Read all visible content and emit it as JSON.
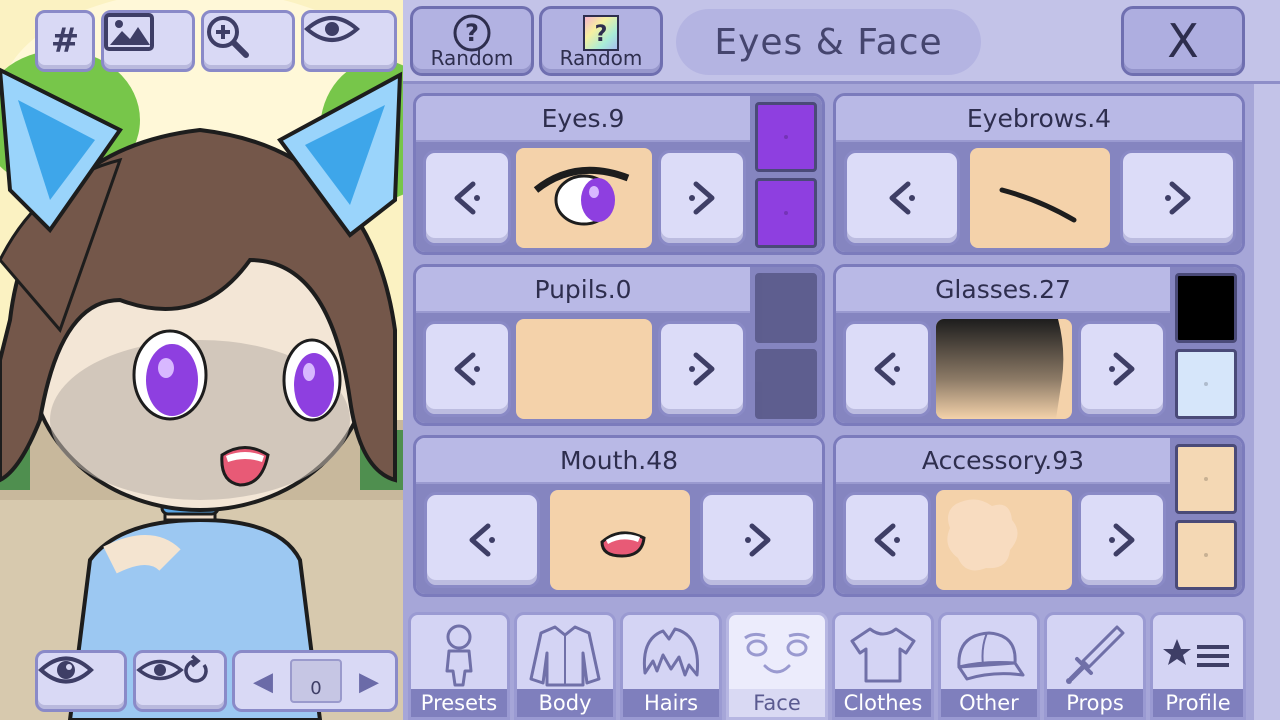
{
  "header": {
    "random_buttons": [
      {
        "icon": "question-mark-icon",
        "label": "Random"
      },
      {
        "icon": "rainbow-question-icon",
        "label": "Random"
      }
    ],
    "title": "Eyes & Face",
    "close_label": "X"
  },
  "stage_tools": {
    "top": [
      {
        "icon": "grid-hash-icon",
        "text": "#"
      },
      {
        "icon": "background-image-icon"
      },
      {
        "icon": "zoom-in-icon"
      },
      {
        "icon": "eye-icon"
      }
    ],
    "bottom": [
      {
        "icon": "view-toggle-eye-icon"
      },
      {
        "icon": "eye-reset-icon"
      }
    ],
    "pose_pager": {
      "prev": "◀",
      "next": "▶",
      "count": "0"
    }
  },
  "face_parts": [
    {
      "label": "Eyes.9",
      "colors": [
        "#8e3fe0",
        "#8e3fe0"
      ],
      "preview": "eye-preview"
    },
    {
      "label": "Eyebrows.4",
      "colors": [],
      "preview": "eyebrow-preview"
    },
    {
      "label": "Pupils.0",
      "colors": [
        "#3e3e66",
        "#3e3e66"
      ],
      "preview": "empty-preview"
    },
    {
      "label": "Glasses.27",
      "colors": [
        "#000000",
        "#d6e6fa"
      ],
      "preview": "glasses-preview"
    },
    {
      "label": "Mouth.48",
      "colors": [],
      "preview": "mouth-preview"
    },
    {
      "label": "Accessory.93",
      "colors": [
        "#f4d8b4",
        "#f4d8b4"
      ],
      "preview": "accessory-preview"
    }
  ],
  "category_tabs": [
    {
      "label": "Presets",
      "icon": "presets-doll-icon",
      "active": false
    },
    {
      "label": "Body",
      "icon": "body-jacket-icon",
      "active": false
    },
    {
      "label": "Hairs",
      "icon": "hair-icon",
      "active": false
    },
    {
      "label": "Face",
      "icon": "face-icon",
      "active": true
    },
    {
      "label": "Clothes",
      "icon": "tshirt-icon",
      "active": false
    },
    {
      "label": "Other",
      "icon": "cap-icon",
      "active": false
    },
    {
      "label": "Props",
      "icon": "sword-icon",
      "active": false
    },
    {
      "label": "Profile",
      "icon": "star-list-icon",
      "active": false
    }
  ],
  "colors": {
    "panel": "#a6a6d8",
    "card": "#c9c9ee",
    "accent": "#7b7bbc",
    "eye_purple": "#8e3fe0"
  }
}
